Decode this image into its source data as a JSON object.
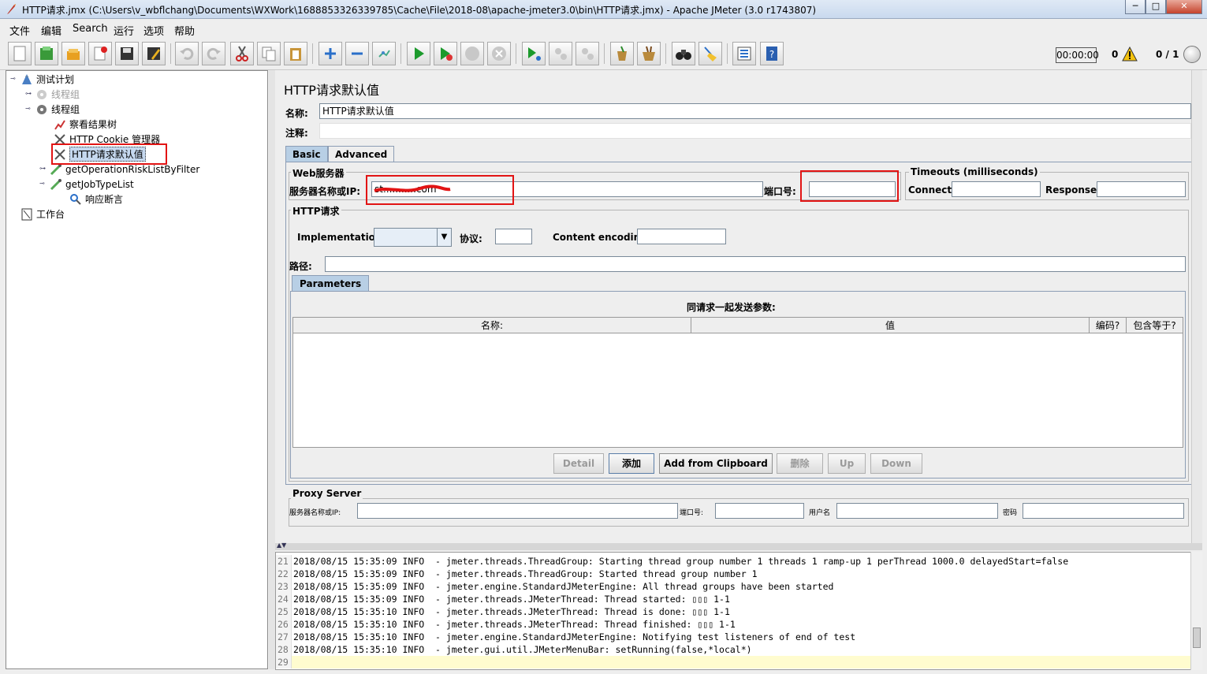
{
  "window": {
    "title": "HTTP请求.jmx (C:\\Users\\v_wbflchang\\Documents\\WXWork\\1688853326339785\\Cache\\File\\2018-08\\apache-jmeter3.0\\bin\\HTTP请求.jmx) - Apache JMeter (3.0 r1743807)",
    "controls": [
      "─",
      "□",
      "✕"
    ]
  },
  "menu": [
    "文件",
    "编辑",
    "Search",
    "运行",
    "选项",
    "帮助"
  ],
  "toolbar": {
    "buttons": [
      "new-icon",
      "templates-icon",
      "open-icon",
      "close-icon",
      "save-icon",
      "save-as-icon",
      "undo-icon",
      "redo-icon",
      "cut-icon",
      "copy-icon",
      "paste-icon",
      "expand-icon",
      "collapse-icon",
      "toggle-icon",
      "start-icon",
      "start-no-timers-icon",
      "stop-icon",
      "shutdown-icon",
      "remote-start-icon",
      "remote-stop-icon",
      "remote-shutdown-icon",
      "clear-icon",
      "clear-all-icon",
      "search-icon",
      "reset-search-icon",
      "function-helper-icon",
      "help-icon"
    ],
    "timer": "00:00:00",
    "error_count": "0",
    "threads": "0 / 1"
  },
  "tree": [
    {
      "label": "测试计划",
      "level": 0,
      "icon": "test-plan-icon",
      "disabled": false
    },
    {
      "label": "线程组",
      "level": 1,
      "icon": "thread-group-icon",
      "disabled": true
    },
    {
      "label": "线程组",
      "level": 1,
      "icon": "thread-group-icon",
      "disabled": false
    },
    {
      "label": "察看结果树",
      "level": 2,
      "icon": "listener-icon",
      "disabled": false
    },
    {
      "label": "HTTP Cookie 管理器",
      "level": 2,
      "icon": "config-icon",
      "disabled": false
    },
    {
      "label": "HTTP请求默认值",
      "level": 2,
      "icon": "config-icon",
      "disabled": false,
      "selected": true
    },
    {
      "label": "getOperationRiskListByFilter",
      "level": 2,
      "icon": "sampler-icon",
      "disabled": false
    },
    {
      "label": "getJobTypeList",
      "level": 2,
      "icon": "sampler-icon",
      "disabled": false
    },
    {
      "label": "响应断言",
      "level": 3,
      "icon": "assertion-icon",
      "disabled": false
    },
    {
      "label": "工作台",
      "level": 0,
      "icon": "workbench-icon",
      "disabled": false
    }
  ],
  "panel": {
    "title": "HTTP请求默认值",
    "name_label": "名称:",
    "name_value": "HTTP请求默认值",
    "comment_label": "注释:",
    "tabs": [
      "Basic",
      "Advanced"
    ],
    "web_server": {
      "legend": "Web服务器",
      "server_label": "服务器名称或IP:",
      "server_value": "st...........com",
      "port_label": "端口号:",
      "port_value": ""
    },
    "timeouts": {
      "legend": "Timeouts (milliseconds)",
      "connect_label": "Connect:",
      "response_label": "Response:"
    },
    "http_request": {
      "legend": "HTTP请求",
      "impl_label": "Implementation:",
      "protocol_label": "协议:",
      "encoding_label": "Content encoding:",
      "path_label": "路径:"
    },
    "params_tab": "Parameters",
    "params_title": "同请求一起发送参数:",
    "columns": [
      "名称:",
      "值",
      "编码?",
      "包含等于?"
    ],
    "buttons": {
      "detail": "Detail",
      "add": "添加",
      "add_clipboard": "Add from Clipboard",
      "delete": "删除",
      "up": "Up",
      "down": "Down"
    },
    "proxy": {
      "legend": "Proxy Server",
      "server_label": "服务器名称或IP:",
      "port_label": "端口号:",
      "user_label": "用户名",
      "password_label": "密码"
    }
  },
  "log": [
    {
      "n": "21",
      "text": "2018/08/15 15:35:09 INFO  - jmeter.threads.ThreadGroup: Starting thread group number 1 threads 1 ramp-up 1 perThread 1000.0 delayedStart=false"
    },
    {
      "n": "22",
      "text": "2018/08/15 15:35:09 INFO  - jmeter.threads.ThreadGroup: Started thread group number 1"
    },
    {
      "n": "23",
      "text": "2018/08/15 15:35:09 INFO  - jmeter.engine.StandardJMeterEngine: All thread groups have been started"
    },
    {
      "n": "24",
      "text": "2018/08/15 15:35:09 INFO  - jmeter.threads.JMeterThread: Thread started: ▯▯▯ 1-1"
    },
    {
      "n": "25",
      "text": "2018/08/15 15:35:10 INFO  - jmeter.threads.JMeterThread: Thread is done: ▯▯▯ 1-1"
    },
    {
      "n": "26",
      "text": "2018/08/15 15:35:10 INFO  - jmeter.threads.JMeterThread: Thread finished: ▯▯▯ 1-1"
    },
    {
      "n": "27",
      "text": "2018/08/15 15:35:10 INFO  - jmeter.engine.StandardJMeterEngine: Notifying test listeners of end of test"
    },
    {
      "n": "28",
      "text": "2018/08/15 15:35:10 INFO  - jmeter.gui.util.JMeterMenuBar: setRunning(false,*local*)"
    },
    {
      "n": "29",
      "text": ""
    }
  ]
}
